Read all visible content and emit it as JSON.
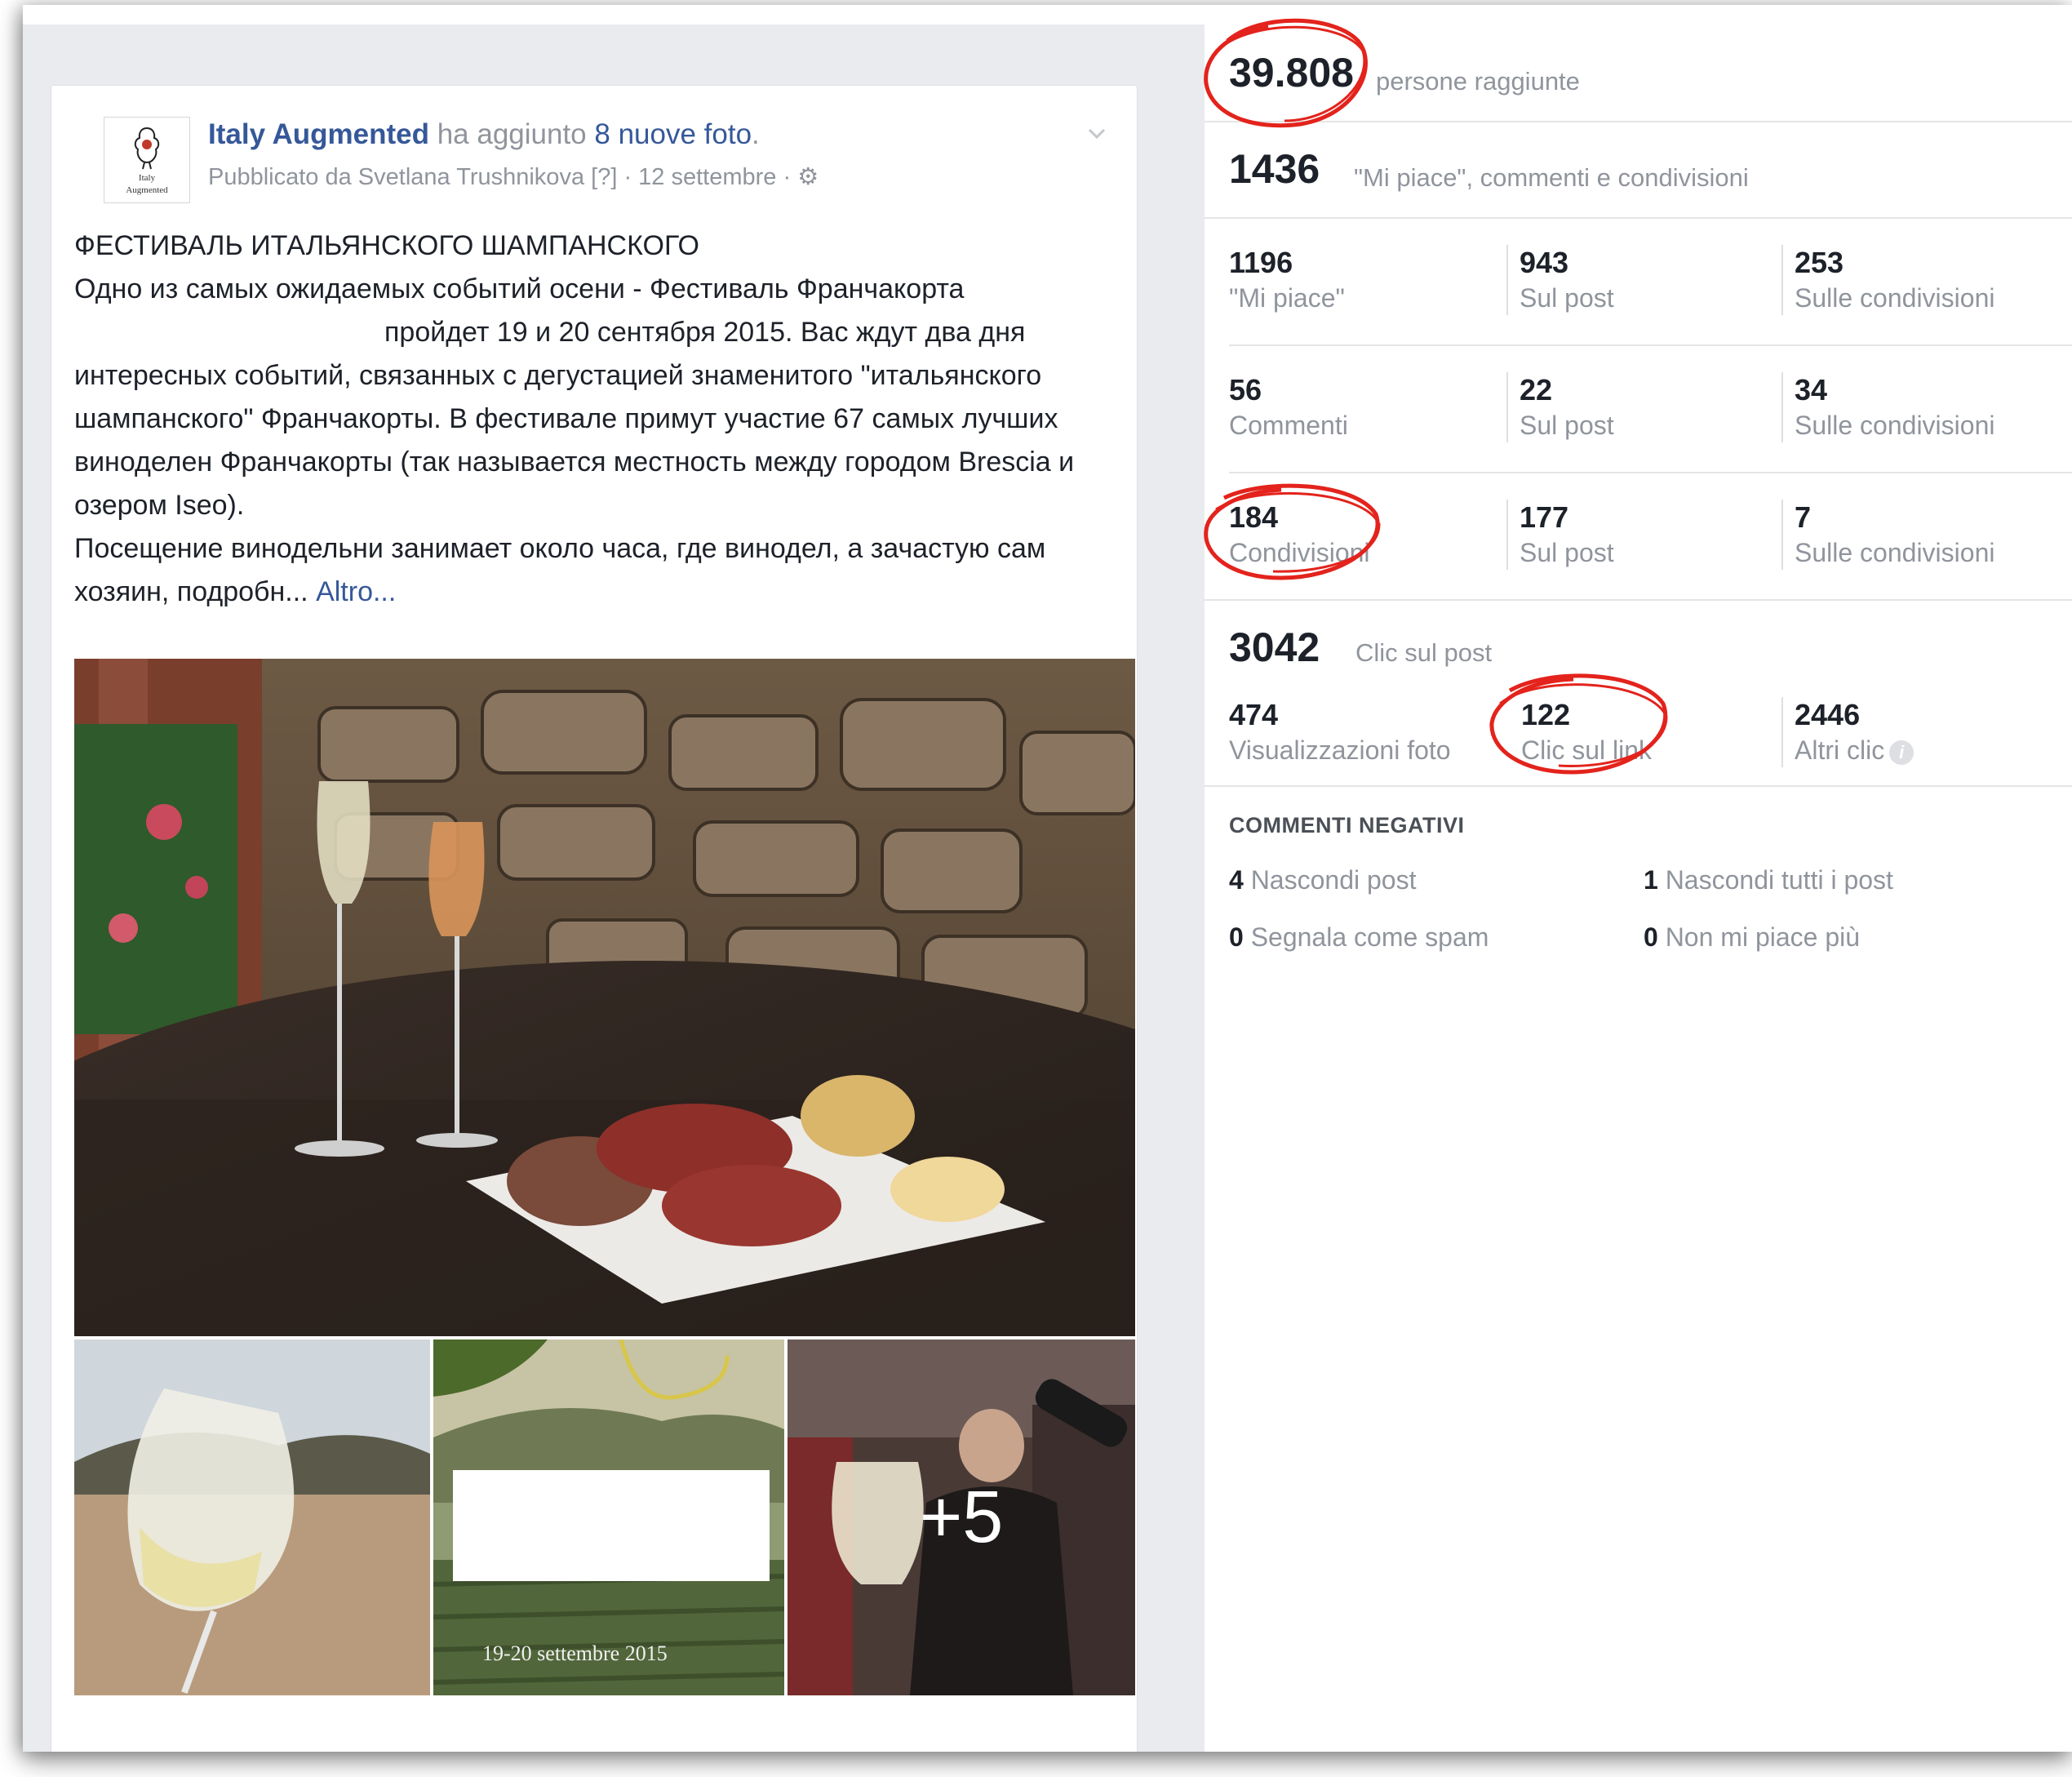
{
  "post": {
    "page_name": "Italy Augmented",
    "action_text": " ha aggiunto ",
    "photos_link": "8 nuove foto",
    "period": ".",
    "published_by": "Pubblicato da Svetlana Trushnikova",
    "help_marker": " [?]",
    "date": " · 12 settembre · ",
    "logo_text_1": "Italy",
    "logo_text_2": "Augmented",
    "text_title": "ФЕСТИВАЛЬ ИТАЛЬЯНСКОГО ШАМПАНСКОГО",
    "text_line1": "Одно из самых ожидаемых событий осени - Фестиваль Франчакорта",
    "text_line2": "пройдет 19 и 20 сентября 2015. Вас ждут два дня интересных событий, связанных с дегустацией знаменитого \"итальянского шампанского\" Франчакорты. В фестивале примут участие 67 самых лучших виноделен Франчакорты (так называется местность между городом Brescia и озером Iseo).",
    "text_para2": "Посещение винодельни занимает около часа, где винодел, а зачастую сам хозяин, подробн... ",
    "more_link": "Altro...",
    "photo_more": "+5",
    "photo_caption": "19-20 settembre 2015"
  },
  "stats": {
    "reach": {
      "value": "39.808",
      "label": "persone raggiunte"
    },
    "engagement": {
      "value": "1436",
      "label": "\"Mi piace\", commenti e condivisioni"
    },
    "rows": [
      {
        "total": "1196",
        "total_label": "\"Mi piace\"",
        "on_post": "943",
        "on_post_label": "Sul post",
        "on_shares": "253",
        "on_shares_label": "Sulle condivisioni"
      },
      {
        "total": "56",
        "total_label": "Commenti",
        "on_post": "22",
        "on_post_label": "Sul post",
        "on_shares": "34",
        "on_shares_label": "Sulle condivisioni"
      },
      {
        "total": "184",
        "total_label": "Condivisioni",
        "on_post": "177",
        "on_post_label": "Sul post",
        "on_shares": "7",
        "on_shares_label": "Sulle condivisioni"
      }
    ],
    "clicks": {
      "value": "3042",
      "label": "Clic sul post"
    },
    "click_breakdown": [
      {
        "value": "474",
        "label": "Visualizzazioni foto"
      },
      {
        "value": "122",
        "label": "Clic sul link"
      },
      {
        "value": "2446",
        "label": "Altri clic"
      }
    ],
    "negative": {
      "title": "COMMENTI NEGATIVI",
      "items": [
        {
          "value": "4",
          "label": " Nascondi post"
        },
        {
          "value": "1",
          "label": " Nascondi tutti i post"
        },
        {
          "value": "0",
          "label": " Segnala come spam"
        },
        {
          "value": "0",
          "label": " Non mi piace più"
        }
      ]
    }
  },
  "colors": {
    "link": "#365899",
    "annotation": "#e3231c",
    "muted": "#90949c"
  },
  "icons": [
    "chevron-down-icon",
    "gear-icon",
    "info-icon",
    "page-logo-icon"
  ]
}
